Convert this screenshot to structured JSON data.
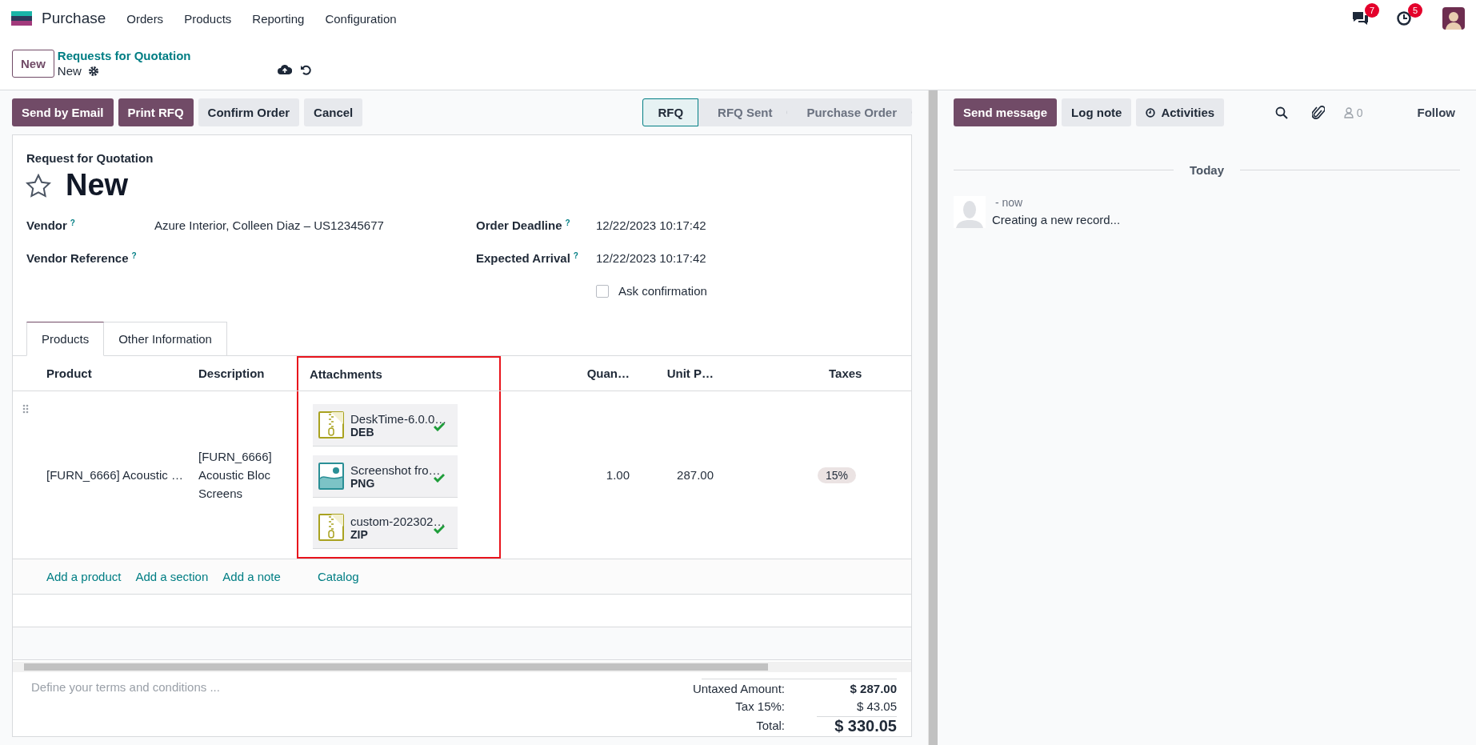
{
  "app": {
    "name": "Purchase",
    "menu": [
      "Orders",
      "Products",
      "Reporting",
      "Configuration"
    ],
    "badges": [
      {
        "kind": "messages",
        "count": "7"
      },
      {
        "kind": "activities",
        "count": "5"
      }
    ]
  },
  "breadcrumb": {
    "new_button": "New",
    "parent": "Requests for Quotation",
    "current": "New"
  },
  "actions": [
    {
      "label": "Send by Email",
      "primary": true
    },
    {
      "label": "Print RFQ",
      "primary": true
    },
    {
      "label": "Confirm Order",
      "primary": false
    },
    {
      "label": "Cancel",
      "primary": false
    }
  ],
  "status_steps": [
    {
      "label": "RFQ",
      "selected": true
    },
    {
      "label": "RFQ Sent",
      "selected": false
    },
    {
      "label": "Purchase Order",
      "selected": false
    }
  ],
  "form": {
    "subtitle": "Request for Quotation",
    "title": "New",
    "starred": false,
    "left_fields": [
      {
        "label": "Vendor",
        "help": "?",
        "value": "Azure Interior, Colleen Diaz – US12345677"
      },
      {
        "label": "Vendor Reference",
        "help": "?"
      }
    ],
    "right_fields": [
      {
        "label": "Order Deadline",
        "help": "?",
        "value": "12/22/2023 10:17:42"
      },
      {
        "label": "Expected Arrival",
        "help": "?",
        "value": "12/22/2023 10:17:42"
      }
    ],
    "ask_confirmation": {
      "label": "Ask confirmation",
      "checked": false
    }
  },
  "tabs": [
    {
      "label": "Products",
      "selected": true
    },
    {
      "label": "Other Information",
      "selected": false
    }
  ],
  "table": {
    "columns": [
      {
        "label": "Product",
        "highlighted": false
      },
      {
        "label": "Description",
        "highlighted": false
      },
      {
        "label": "Attachments",
        "highlighted": true
      },
      {
        "label": "Quan…",
        "highlighted": false
      },
      {
        "label": "Unit P…",
        "highlighted": false
      },
      {
        "label": "Taxes",
        "highlighted": false
      }
    ],
    "rows": [
      {
        "product": "[FURN_6666] Acoustic …",
        "description": "[FURN_6666] Acoustic Bloc Screens",
        "attachments": [
          {
            "name": "DeskTime-6.0.0…",
            "type": "DEB",
            "kind": "archive",
            "uploaded": true
          },
          {
            "name": "Screenshot fro…",
            "type": "PNG",
            "kind": "image",
            "uploaded": true
          },
          {
            "name": "custom-202302…",
            "type": "ZIP",
            "kind": "archive",
            "uploaded": true
          }
        ],
        "quantity": "1.00",
        "unit_price": "287.00",
        "taxes": [
          "15%"
        ]
      }
    ],
    "add_links": [
      "Add a product",
      "Add a section",
      "Add a note",
      "Catalog"
    ]
  },
  "terms": {
    "placeholder": "Define your terms and conditions ..."
  },
  "totals": [
    {
      "label": "Untaxed Amount:",
      "value": "$ 287.00",
      "kind": "subtotal"
    },
    {
      "label": "Tax 15%:",
      "value": "$ 43.05",
      "kind": "tax"
    },
    {
      "label": "Total:",
      "value": "$ 330.05",
      "kind": "total"
    }
  ],
  "chatter": {
    "buttons": [
      {
        "label": "Send message",
        "kind": "message"
      },
      {
        "label": "Log note",
        "kind": "note"
      },
      {
        "label": "Activities",
        "kind": "activities"
      }
    ],
    "followers": "0",
    "follow": "Follow",
    "separator": "Today",
    "messages": [
      {
        "time": "- now",
        "body": "Creating a new record..."
      }
    ]
  }
}
